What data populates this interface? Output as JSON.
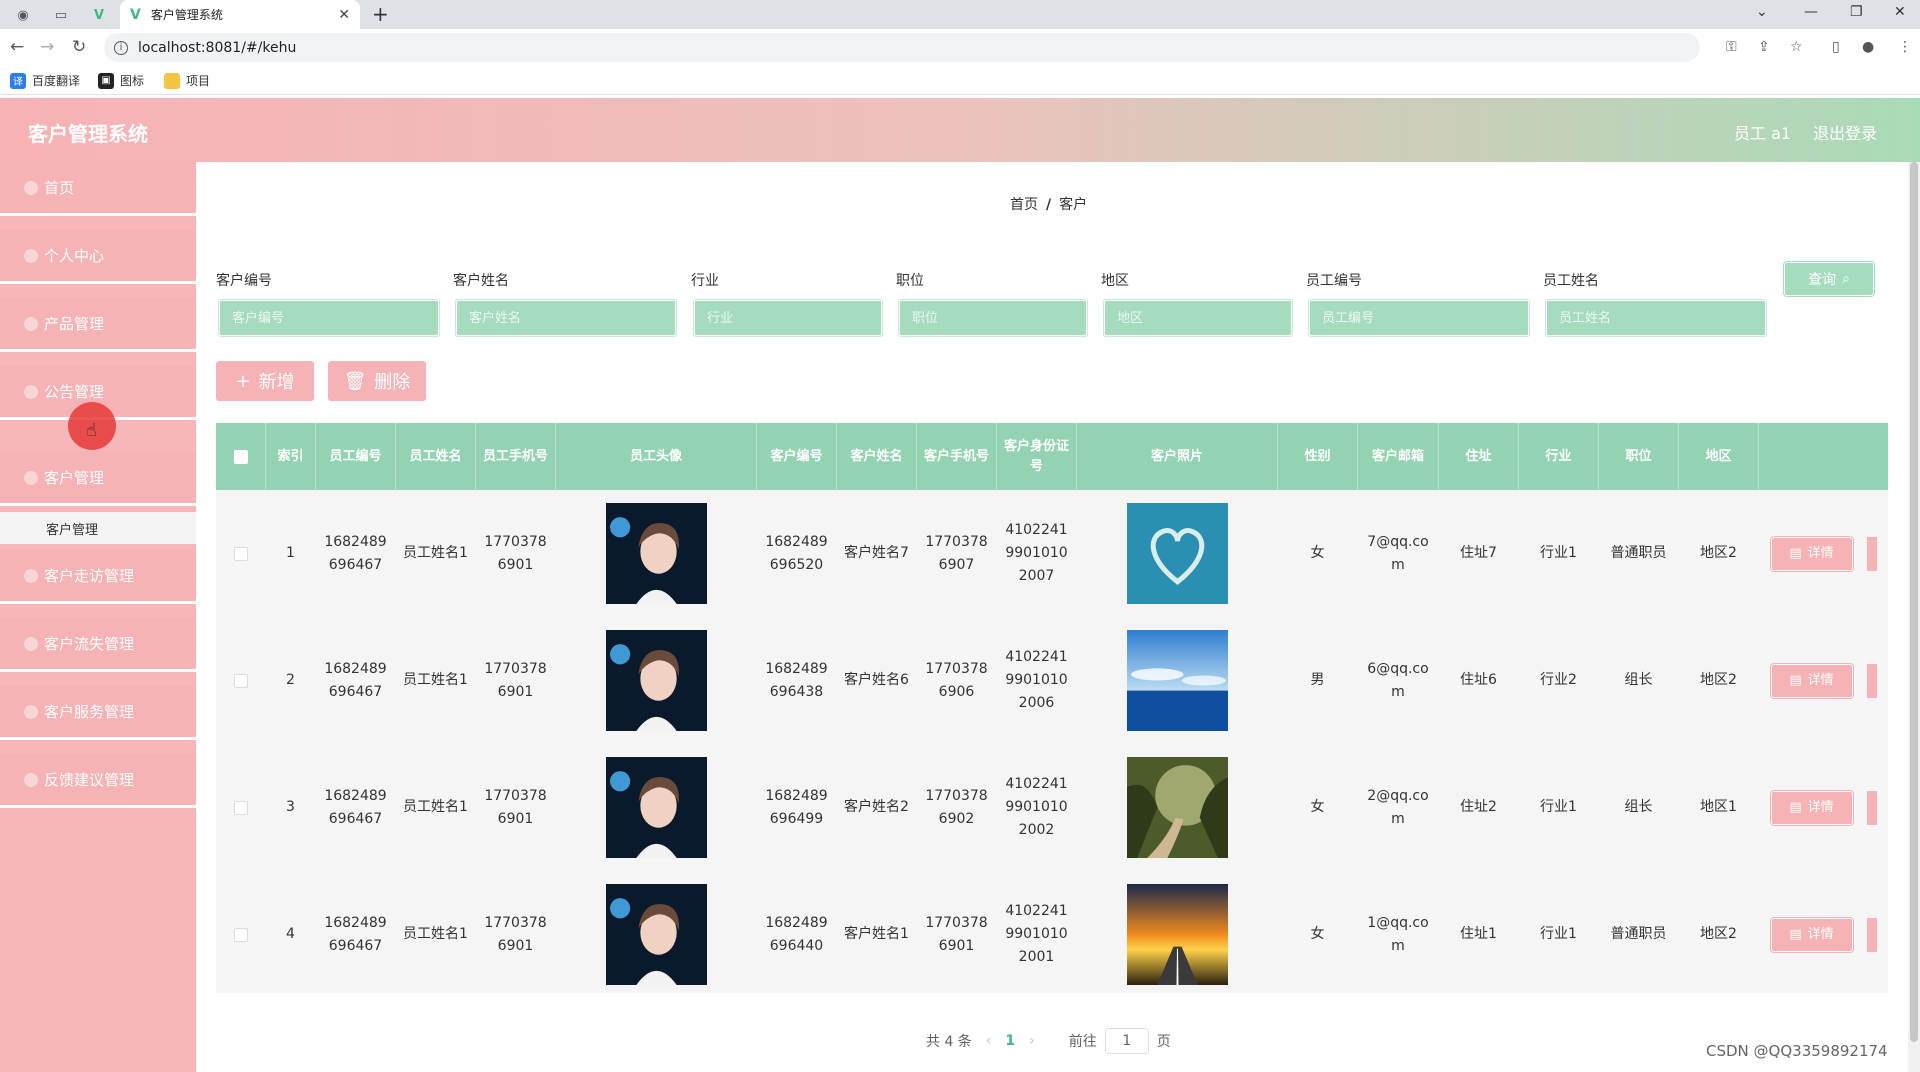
{
  "browser": {
    "tab_title": "客户管理系统",
    "url": "localhost:8081/#/kehu",
    "bookmarks": [
      {
        "label": "百度翻译",
        "icon": "translate-icon"
      },
      {
        "label": "图标",
        "icon": "image-icon"
      },
      {
        "label": "项目",
        "icon": "folder-icon"
      }
    ]
  },
  "app": {
    "title": "客户管理系统",
    "user": "员工 a1",
    "logout": "退出登录"
  },
  "sidebar": {
    "items": [
      {
        "label": "首页"
      },
      {
        "label": "个人中心"
      },
      {
        "label": "产品管理"
      },
      {
        "label": "公告管理"
      },
      {
        "label": "客户管理"
      },
      {
        "label": "客户走访管理"
      },
      {
        "label": "客户流失管理"
      },
      {
        "label": "客户服务管理"
      },
      {
        "label": "反馈建议管理"
      }
    ],
    "submenu_label": "客户管理"
  },
  "breadcrumb": {
    "home": "首页",
    "separator": "/",
    "current": "客户"
  },
  "filters": [
    {
      "label": "客户编号",
      "placeholder": "客户编号"
    },
    {
      "label": "客户姓名",
      "placeholder": "客户姓名"
    },
    {
      "label": "行业",
      "placeholder": "行业"
    },
    {
      "label": "职位",
      "placeholder": "职位"
    },
    {
      "label": "地区",
      "placeholder": "地区"
    },
    {
      "label": "员工编号",
      "placeholder": "员工编号"
    },
    {
      "label": "员工姓名",
      "placeholder": "员工姓名"
    }
  ],
  "buttons": {
    "query": "查询",
    "add": "新增",
    "delete": "删除",
    "detail": "详情"
  },
  "table": {
    "headers": [
      "索引",
      "员工编号",
      "员工姓名",
      "员工手机号",
      "员工头像",
      "客户编号",
      "客户姓名",
      "客户手机号",
      "客户身份证号",
      "客户照片",
      "性别",
      "客户邮箱",
      "住址",
      "行业",
      "职位",
      "地区"
    ],
    "rows": [
      {
        "index": "1",
        "emp_no": "1682489696467",
        "emp_name": "员工姓名1",
        "emp_phone": "17703786901",
        "cust_no": "1682489696520",
        "cust_name": "客户姓名7",
        "cust_phone": "17703786907",
        "id_card": "410224199010102007",
        "photo": "heart-island",
        "gender": "女",
        "email": "7@qq.com",
        "address": "住址7",
        "industry": "行业1",
        "position": "普通职员",
        "region": "地区2"
      },
      {
        "index": "2",
        "emp_no": "1682489696467",
        "emp_name": "员工姓名1",
        "emp_phone": "17703786901",
        "cust_no": "1682489696438",
        "cust_name": "客户姓名6",
        "cust_phone": "17703786906",
        "id_card": "410224199010102006",
        "photo": "ocean",
        "gender": "男",
        "email": "6@qq.com",
        "address": "住址6",
        "industry": "行业2",
        "position": "组长",
        "region": "地区2"
      },
      {
        "index": "3",
        "emp_no": "1682489696467",
        "emp_name": "员工姓名1",
        "emp_phone": "17703786901",
        "cust_no": "1682489696499",
        "cust_name": "客户姓名2",
        "cust_phone": "17703786902",
        "id_card": "410224199010102002",
        "photo": "forest-road",
        "gender": "女",
        "email": "2@qq.com",
        "address": "住址2",
        "industry": "行业1",
        "position": "组长",
        "region": "地区1"
      },
      {
        "index": "4",
        "emp_no": "1682489696467",
        "emp_name": "员工姓名1",
        "emp_phone": "17703786901",
        "cust_no": "1682489696440",
        "cust_name": "客户姓名1",
        "cust_phone": "17703786901",
        "id_card": "410224199010102001",
        "photo": "sunset-road",
        "gender": "女",
        "email": "1@qq.com",
        "address": "住址1",
        "industry": "行业1",
        "position": "普通职员",
        "region": "地区2"
      }
    ]
  },
  "pagination": {
    "total": "共 4 条",
    "current": "1",
    "goto_prefix": "前往",
    "goto_value": "1",
    "goto_suffix": "页"
  },
  "watermark": "CSDN @QQ3359892174",
  "colors": {
    "primary_green": "#93d3b1",
    "primary_pink": "#f6b3b5",
    "header_gradient_start": "#f7b2b5",
    "header_gradient_end": "#a9dab8"
  }
}
